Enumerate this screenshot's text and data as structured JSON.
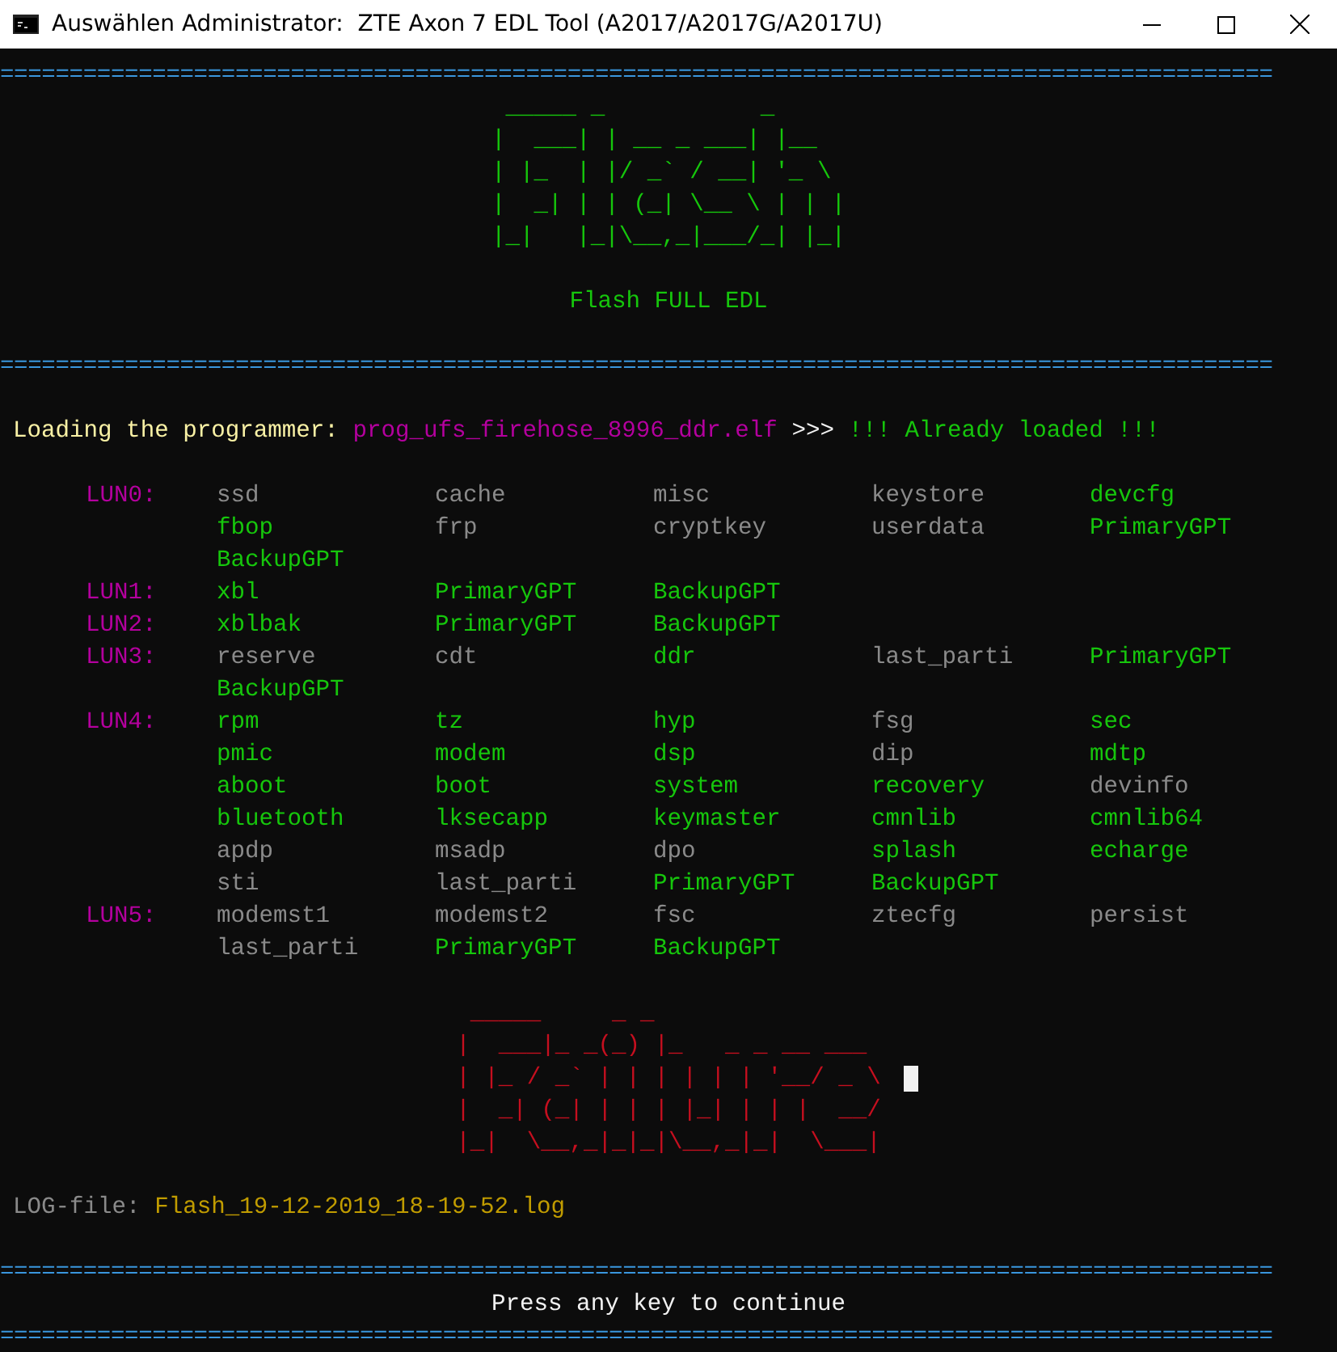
{
  "window": {
    "title": "Auswählen Administrator:  ZTE Axon 7 EDL Tool (A2017/A2017G/A2017U)"
  },
  "separator_top": "============================================================================================",
  "flash_banner": {
    "art": [
      " _____ _           _",
      "|  ___| | __ _ ___| |__",
      "| |_  | |/ _` / __| '_ \\",
      "|  _| | | (_| \\__ \\ | | |",
      "|_|   |_|\\__,_|___/_| |_|"
    ],
    "subtitle": "Flash FULL EDL"
  },
  "separator_mid": "============================================================================================",
  "loading": {
    "label": "Loading the programmer:",
    "file": "prog_ufs_firehose_8996_ddr.elf",
    "arrow": ">>>",
    "status": "!!! Already loaded !!!"
  },
  "luns": [
    {
      "label": "LUN0:",
      "partitions": [
        {
          "name": "ssd",
          "color": "#8a8a8a"
        },
        {
          "name": "cache",
          "color": "#8a8a8a"
        },
        {
          "name": "misc",
          "color": "#8a8a8a"
        },
        {
          "name": "keystore",
          "color": "#8a8a8a"
        },
        {
          "name": "devcfg",
          "color": "#16c60c"
        },
        {
          "name": "fbop",
          "color": "#16c60c"
        },
        {
          "name": "frp",
          "color": "#8a8a8a"
        },
        {
          "name": "cryptkey",
          "color": "#8a8a8a"
        },
        {
          "name": "userdata",
          "color": "#8a8a8a"
        },
        {
          "name": "PrimaryGPT",
          "color": "#16c60c"
        },
        {
          "name": "BackupGPT",
          "color": "#16c60c"
        }
      ]
    },
    {
      "label": "LUN1:",
      "partitions": [
        {
          "name": "xbl",
          "color": "#16c60c"
        },
        {
          "name": "PrimaryGPT",
          "color": "#16c60c"
        },
        {
          "name": "BackupGPT",
          "color": "#16c60c"
        }
      ]
    },
    {
      "label": "LUN2:",
      "partitions": [
        {
          "name": "xblbak",
          "color": "#16c60c"
        },
        {
          "name": "PrimaryGPT",
          "color": "#16c60c"
        },
        {
          "name": "BackupGPT",
          "color": "#16c60c"
        }
      ]
    },
    {
      "label": "LUN3:",
      "partitions": [
        {
          "name": "reserve",
          "color": "#8a8a8a"
        },
        {
          "name": "cdt",
          "color": "#8a8a8a"
        },
        {
          "name": "ddr",
          "color": "#16c60c"
        },
        {
          "name": "last_parti",
          "color": "#8a8a8a"
        },
        {
          "name": "PrimaryGPT",
          "color": "#16c60c"
        },
        {
          "name": "BackupGPT",
          "color": "#16c60c"
        }
      ]
    },
    {
      "label": "LUN4:",
      "partitions": [
        {
          "name": "rpm",
          "color": "#16c60c"
        },
        {
          "name": "tz",
          "color": "#16c60c"
        },
        {
          "name": "hyp",
          "color": "#16c60c"
        },
        {
          "name": "fsg",
          "color": "#8a8a8a"
        },
        {
          "name": "sec",
          "color": "#16c60c"
        },
        {
          "name": "pmic",
          "color": "#16c60c"
        },
        {
          "name": "modem",
          "color": "#16c60c"
        },
        {
          "name": "dsp",
          "color": "#16c60c"
        },
        {
          "name": "dip",
          "color": "#8a8a8a"
        },
        {
          "name": "mdtp",
          "color": "#16c60c"
        },
        {
          "name": "aboot",
          "color": "#16c60c"
        },
        {
          "name": "boot",
          "color": "#16c60c"
        },
        {
          "name": "system",
          "color": "#16c60c"
        },
        {
          "name": "recovery",
          "color": "#16c60c"
        },
        {
          "name": "devinfo",
          "color": "#8a8a8a"
        },
        {
          "name": "bluetooth",
          "color": "#16c60c"
        },
        {
          "name": "lksecapp",
          "color": "#16c60c"
        },
        {
          "name": "keymaster",
          "color": "#16c60c"
        },
        {
          "name": "cmnlib",
          "color": "#16c60c"
        },
        {
          "name": "cmnlib64",
          "color": "#16c60c"
        },
        {
          "name": "apdp",
          "color": "#8a8a8a"
        },
        {
          "name": "msadp",
          "color": "#8a8a8a"
        },
        {
          "name": "dpo",
          "color": "#8a8a8a"
        },
        {
          "name": "splash",
          "color": "#16c60c"
        },
        {
          "name": "echarge",
          "color": "#16c60c"
        },
        {
          "name": "sti",
          "color": "#8a8a8a"
        },
        {
          "name": "last_parti",
          "color": "#8a8a8a"
        },
        {
          "name": "PrimaryGPT",
          "color": "#16c60c"
        },
        {
          "name": "BackupGPT",
          "color": "#16c60c"
        }
      ]
    },
    {
      "label": "LUN5:",
      "partitions": [
        {
          "name": "modemst1",
          "color": "#8a8a8a"
        },
        {
          "name": "modemst2",
          "color": "#8a8a8a"
        },
        {
          "name": "fsc",
          "color": "#8a8a8a"
        },
        {
          "name": "ztecfg",
          "color": "#8a8a8a"
        },
        {
          "name": "persist",
          "color": "#8a8a8a"
        },
        {
          "name": "last_parti",
          "color": "#8a8a8a"
        },
        {
          "name": "PrimaryGPT",
          "color": "#16c60c"
        },
        {
          "name": "BackupGPT",
          "color": "#16c60c"
        }
      ]
    }
  ],
  "failure_banner": {
    "art": [
      " _____     _ _",
      "|  ___|_ _(_) |_   _ _ __ ___",
      "| |_ / _` | | | | | | '__/ _ \\",
      "|  _| (_| | | | |_| | | |  __/",
      "|_|  \\__,_|_|_|\\__,_|_|  \\___|"
    ]
  },
  "log": {
    "label": "LOG-file:",
    "file": "Flash_19-12-2019_18-19-52.log"
  },
  "separator_bottom": "============================================================================================",
  "prompt": "Press any key to continue",
  "separator_end": "============================================================================================"
}
